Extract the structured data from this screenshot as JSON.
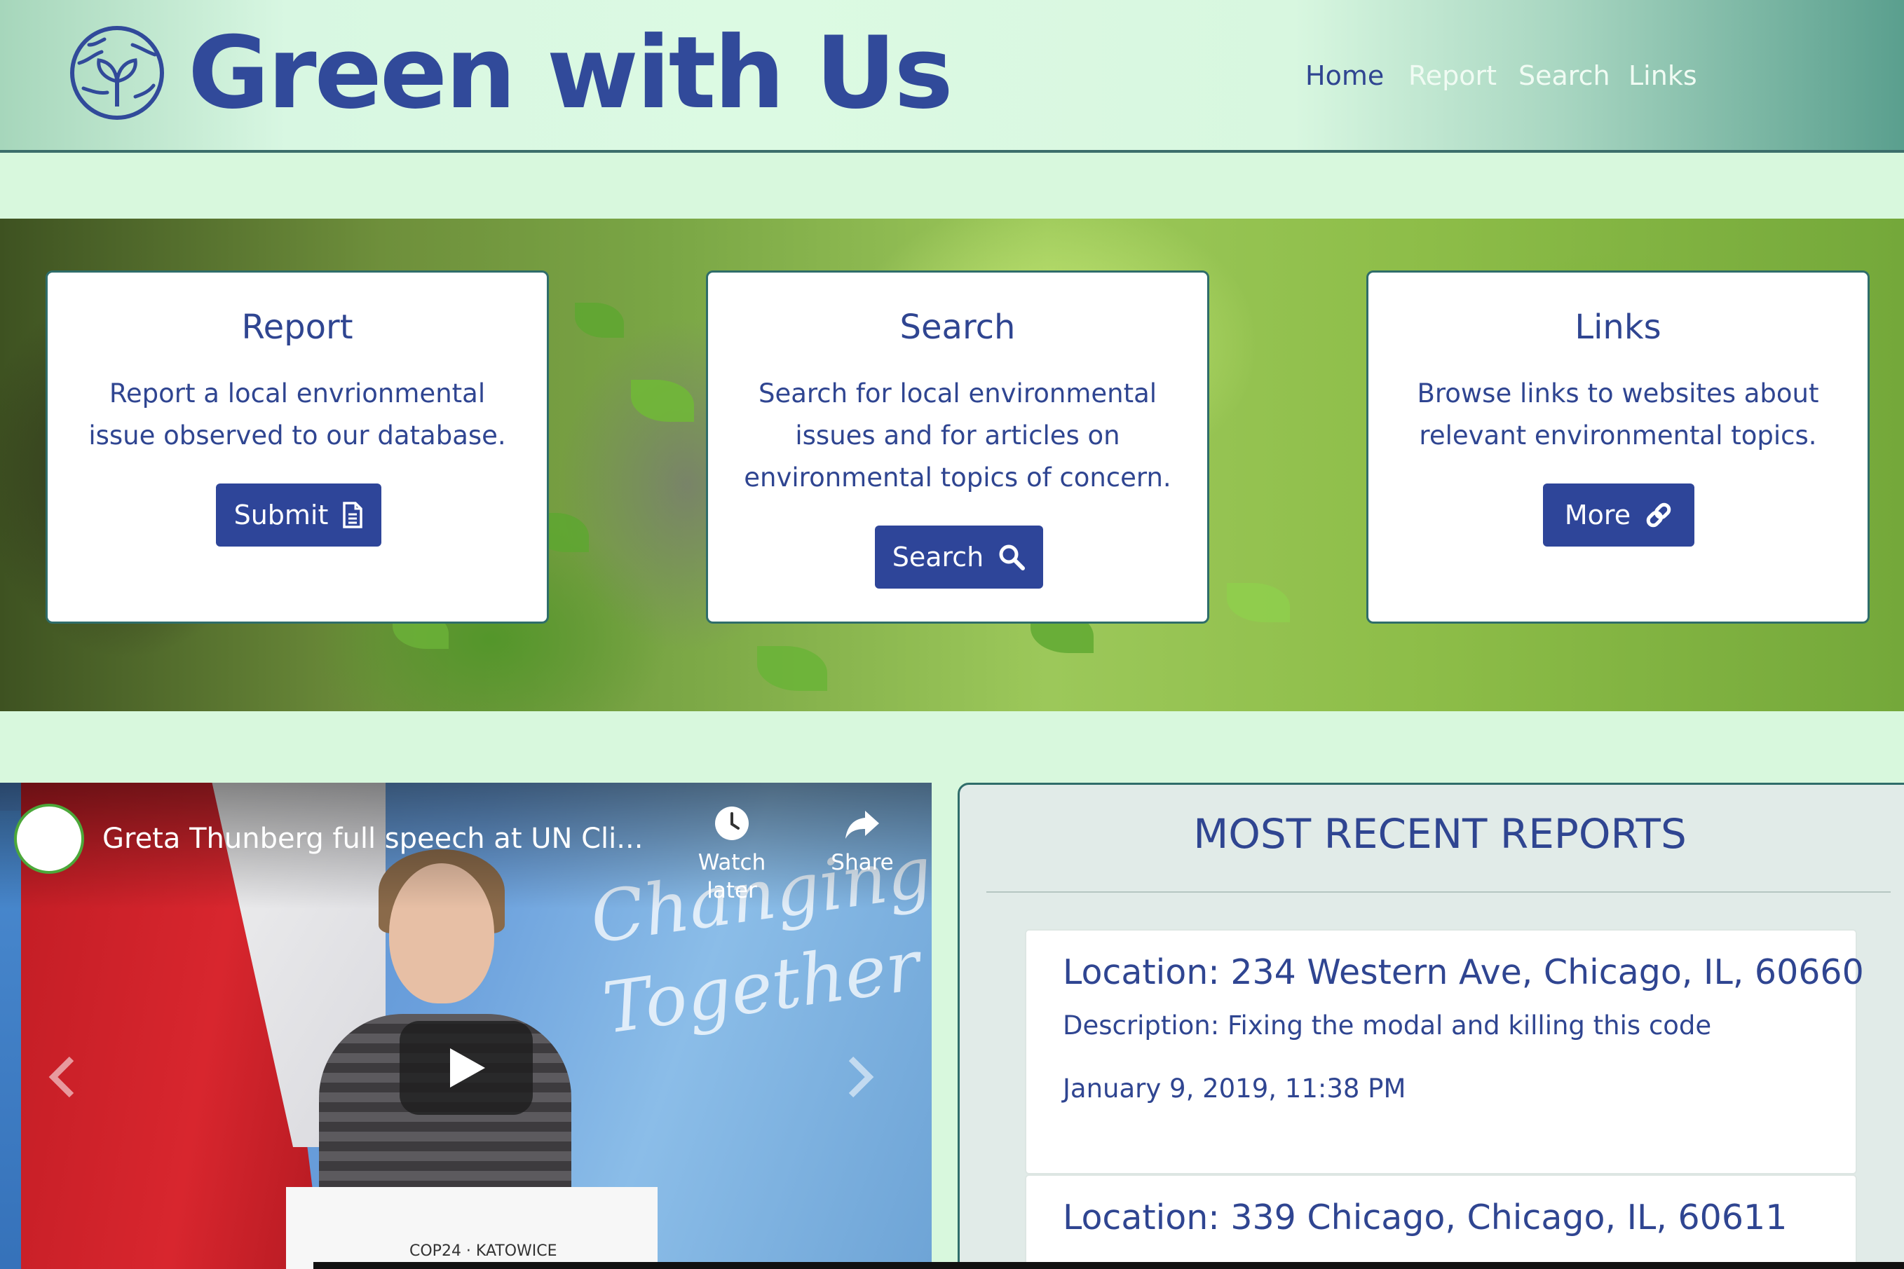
{
  "header": {
    "brand": "Green with Us",
    "logo_icon": "globe-plant-icon",
    "nav": [
      {
        "label": "Home"
      },
      {
        "label": "Report"
      },
      {
        "label": "Search"
      },
      {
        "label": "Links"
      }
    ],
    "colors": {
      "brand": "#314a9a",
      "nav_active": "#2f4591",
      "nav_inactive": "#f0fbf3"
    }
  },
  "cards": [
    {
      "title": "Report",
      "text": "Report a local envrionmental issue observed to our database.",
      "button": "Submit",
      "icon": "document-icon"
    },
    {
      "title": "Search",
      "text": "Search for local environmental issues and for articles on environmental topics of concern.",
      "button": "Search",
      "icon": "search-icon"
    },
    {
      "title": "Links",
      "text": "Browse links to websites about relevant environmental topics.",
      "button": "More",
      "icon": "link-icon"
    }
  ],
  "video": {
    "title": "Greta Thunberg full speech at UN Cli...",
    "watch_later": "Watch later",
    "share": "Share",
    "watermark": "Changing\nTogether",
    "podium": "COP24 · KATOWICE"
  },
  "reports": {
    "heading": "MOST RECENT REPORTS",
    "items": [
      {
        "location": "Location: 234 Western Ave, Chicago, IL, 60660",
        "description": "Description: Fixing the modal and killing this code",
        "date": "January 9, 2019, 11:38 PM"
      },
      {
        "location": "Location: 339 Chicago, Chicago, IL, 60611"
      }
    ]
  },
  "colors": {
    "page_bg": "#d8f8dd",
    "button": "#2e4599",
    "card_border": "#2f6d6a",
    "text": "#2f4591"
  }
}
